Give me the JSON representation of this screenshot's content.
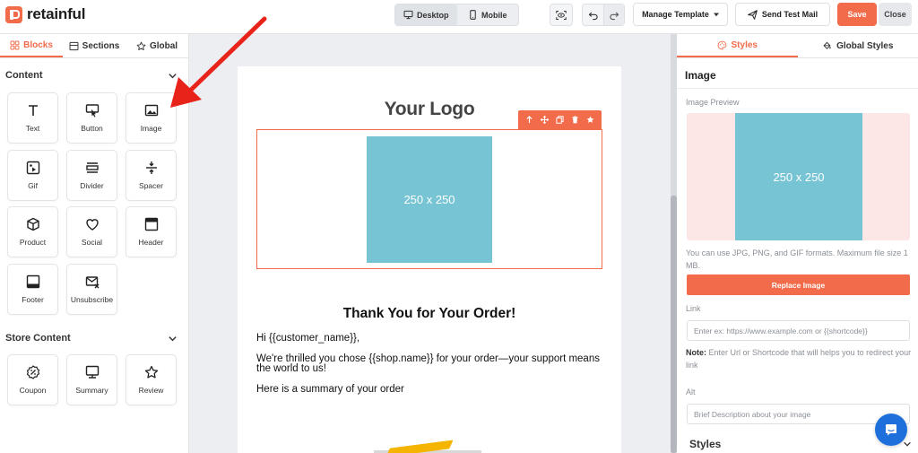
{
  "app": {
    "name": "retainful"
  },
  "toolbar": {
    "device_options": [
      "Desktop",
      "Mobile"
    ],
    "active_device": "Desktop",
    "manage_template_label": "Manage Template",
    "send_test_label": "Send Test Mail",
    "save_label": "Save",
    "close_label": "Close"
  },
  "left_panel": {
    "tabs": [
      "Blocks",
      "Sections",
      "Global"
    ],
    "active_tab": "Blocks",
    "content_section": {
      "title": "Content",
      "blocks": [
        {
          "label": "Text",
          "icon": "text-icon"
        },
        {
          "label": "Button",
          "icon": "button-icon"
        },
        {
          "label": "Image",
          "icon": "image-icon"
        },
        {
          "label": "Gif",
          "icon": "gif-icon"
        },
        {
          "label": "Divider",
          "icon": "divider-icon"
        },
        {
          "label": "Spacer",
          "icon": "spacer-icon"
        },
        {
          "label": "Product",
          "icon": "product-icon"
        },
        {
          "label": "Social",
          "icon": "heart-icon"
        },
        {
          "label": "Header",
          "icon": "header-icon"
        },
        {
          "label": "Footer",
          "icon": "footer-icon"
        },
        {
          "label": "Unsubscribe",
          "icon": "unsubscribe-icon"
        }
      ]
    },
    "store_section": {
      "title": "Store Content",
      "blocks": [
        {
          "label": "Coupon",
          "icon": "coupon-icon"
        },
        {
          "label": "Summary",
          "icon": "summary-icon"
        },
        {
          "label": "Review",
          "icon": "star-icon"
        }
      ]
    }
  },
  "email": {
    "logo_text": "Your Logo",
    "image_placeholder": "250 x 250",
    "heading": "Thank You for Your Order!",
    "greeting": "Hi {{customer_name}},",
    "body": "We're thrilled you chose {{shop.name}} for your order—your support means the world to us!",
    "summary_line": "Here is a summary of your order",
    "block_toolbar_icons": [
      "arrow-up-icon",
      "move-icon",
      "copy-icon",
      "trash-icon",
      "star-icon"
    ]
  },
  "right_panel": {
    "tabs": [
      "Styles",
      "Global Styles"
    ],
    "active_tab": "Styles",
    "title": "Image",
    "preview_label": "Image Preview",
    "preview_placeholder": "250 x 250",
    "format_hint": "You can use JPG, PNG, and GIF formats. Maximum file size 1 MB.",
    "replace_button": "Replace Image",
    "link_label": "Link",
    "link_placeholder": "Enter ex: https://www.example.com or {{shortcode}}",
    "note_label": "Note:",
    "note_text": " Enter Url or Shortcode that will helps you to redirect your link",
    "alt_label": "Alt",
    "alt_placeholder": "Brief Description about your image",
    "styles_section": "Styles"
  },
  "colors": {
    "accent": "#f26b4a",
    "placeholder_image": "#77c4d4",
    "preview_background": "#fde6e6",
    "annotation_arrow": "#e8231a",
    "chat": "#1d6fdc"
  }
}
